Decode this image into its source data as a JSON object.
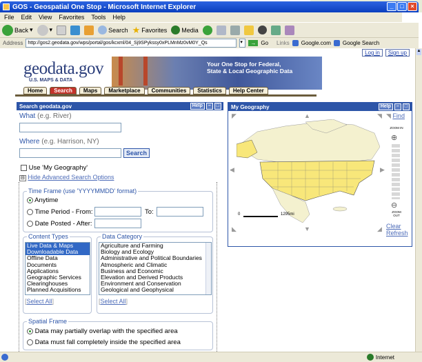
{
  "window": {
    "title": "GOS - Geospatial One Stop - Microsoft Internet Explorer",
    "menu": [
      "File",
      "Edit",
      "View",
      "Favorites",
      "Tools",
      "Help"
    ],
    "toolbar": {
      "back": "Back",
      "search": "Search",
      "favorites": "Favorites",
      "media": "Media"
    },
    "address_label": "Address",
    "address_value": "http://gos2.geodata.gov/wps/portal/gos/kcxml/04_Sj9SPykssy0xPLMnMz0vM0Y_Qs",
    "go_label": "Go",
    "links_label": "Links",
    "links": [
      "Google.com",
      "Google Search"
    ],
    "status_zone": "Internet"
  },
  "site": {
    "logo": "geodata.gov",
    "logo_sub": "U.S. MAPS & DATA",
    "tagline_line1": "Your One Stop for Federal,",
    "tagline_line2": "State & Local Geographic Data",
    "top_links": [
      "Log in",
      "Sign up"
    ],
    "tabs": [
      "Home",
      "Search",
      "Maps",
      "Marketplace",
      "Communities",
      "Statistics",
      "Help Center"
    ],
    "active_tab": "Search"
  },
  "search_panel": {
    "title": "Search geodata.gov",
    "help": "Help",
    "what_label": "What",
    "what_hint": "(e.g. River)",
    "where_label": "Where",
    "where_hint": "(e.g. Harrison, NY)",
    "search_button": "Search",
    "use_geo_label": "Use 'My Geography'",
    "hide_options": "Hide Advanced Search Options",
    "time_frame": {
      "legend": "Time Frame (use 'YYYYMMDD' format)",
      "anytime": "Anytime",
      "period_from": "Time Period - From:",
      "period_to": "To:",
      "posted_after": "Date Posted - After:"
    },
    "content_types": {
      "legend": "Content Types",
      "items": [
        "Live Data & Maps",
        "Downloadable Data",
        "Offline Data",
        "Documents",
        "Applications",
        "Geographic Services",
        "Clearinghouses",
        "Planned Acquisitions"
      ],
      "select_all": "Select All"
    },
    "data_category": {
      "legend": "Data Category",
      "items": [
        "Agriculture and Farming",
        "Biology and Ecology",
        "Administrative and Political Boundaries",
        "Atmospheric and Climatic",
        "Business and Economic",
        "Elevation and Derived Products",
        "Environment and Conservation",
        "Geological and Geophysical"
      ],
      "select_all": "Select All"
    },
    "spatial_frame": {
      "legend": "Spatial Frame",
      "overlap": "Data may partially overlap with the specified area",
      "inside": "Data must fall completely inside the specified area"
    }
  },
  "geo_panel": {
    "title": "My Geography",
    "help": "Help",
    "find": "Find",
    "zoom_in": "ZOOM IN",
    "zoom_out": "ZOOM OUT",
    "scale_start": "0",
    "scale_end": "1295mi",
    "clear": "Clear",
    "refresh": "Refresh"
  }
}
